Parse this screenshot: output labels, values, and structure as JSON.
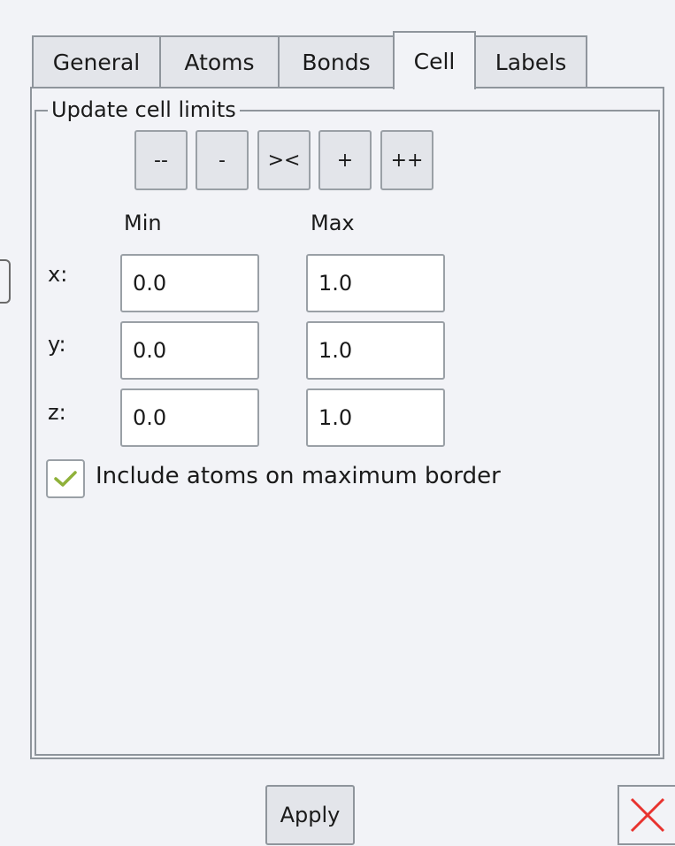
{
  "tabs": [
    {
      "label": "General"
    },
    {
      "label": "Atoms"
    },
    {
      "label": "Bonds"
    },
    {
      "label": "Cell",
      "active": true
    },
    {
      "label": "Labels"
    }
  ],
  "group": {
    "title": "Update cell limits"
  },
  "step_buttons": [
    "--",
    "-",
    "><",
    "+",
    "++"
  ],
  "columns": {
    "min": "Min",
    "max": "Max"
  },
  "rows": [
    {
      "axis": "x:",
      "min": "0.0",
      "max": "1.0"
    },
    {
      "axis": "y:",
      "min": "0.0",
      "max": "1.0"
    },
    {
      "axis": "z:",
      "min": "0.0",
      "max": "1.0"
    }
  ],
  "include_border": {
    "label": "Include atoms on maximum border",
    "checked": true
  },
  "footer": {
    "apply_label": "Apply"
  },
  "icons": {
    "check": "check-icon",
    "close": "close-icon"
  },
  "colors": {
    "check": "#8fb13a",
    "close": "#e8332f"
  }
}
